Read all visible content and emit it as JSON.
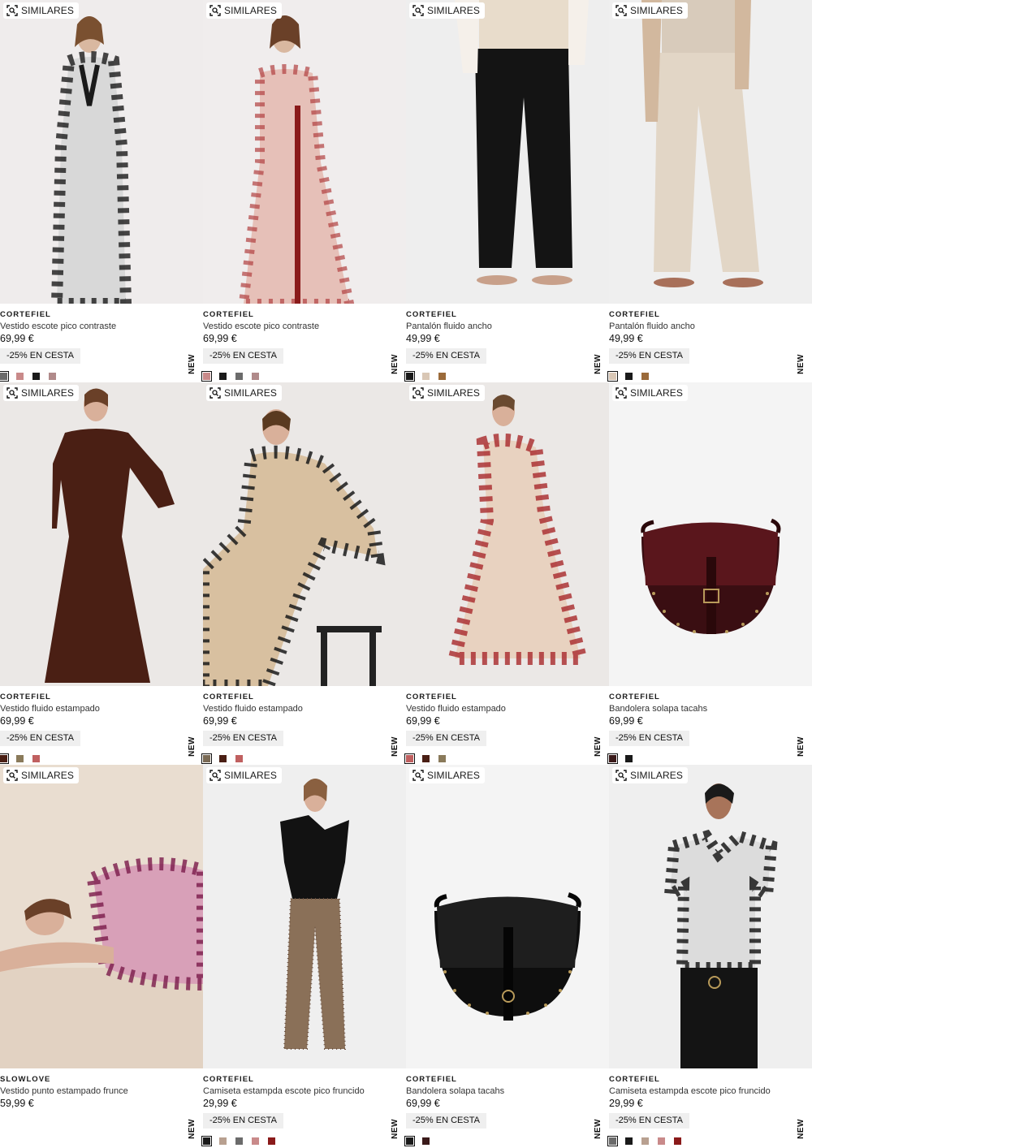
{
  "similar_label": "SIMILARES",
  "new_label": "NEW",
  "products": [
    {
      "brand": "CORTEFIEL",
      "name": "Vestido escote pico contraste",
      "price": "69,99 €",
      "promo": "-25% EN CESTA",
      "bg": "#efecec",
      "swatches": [
        "#6b6b6b",
        "#c98a8a",
        "#1a1a1a",
        "#b08a8a"
      ]
    },
    {
      "brand": "CORTEFIEL",
      "name": "Vestido escote pico contraste",
      "price": "69,99 €",
      "promo": "-25% EN CESTA",
      "bg": "#f0eded",
      "swatches": [
        "#c98a8a",
        "#1a1a1a",
        "#6b6b6b",
        "#b08a8a"
      ]
    },
    {
      "brand": "CORTEFIEL",
      "name": "Pantalón fluido ancho",
      "price": "49,99 €",
      "promo": "-25% EN CESTA",
      "bg": "#eeeeee",
      "swatches": [
        "#1a1a1a",
        "#d9c7b5",
        "#9b6a3a"
      ]
    },
    {
      "brand": "CORTEFIEL",
      "name": "Pantalón fluido ancho",
      "price": "49,99 €",
      "promo": "-25% EN CESTA",
      "bg": "#efefef",
      "swatches": [
        "#d9c7b5",
        "#1a1a1a",
        "#9b6a3a"
      ]
    },
    {
      "brand": "CORTEFIEL",
      "name": "Vestido fluido estampado",
      "price": "69,99 €",
      "promo": "-25% EN CESTA",
      "bg": "#ebe8e6",
      "swatches": [
        "#4a1f14",
        "#8a7a5a",
        "#c06060"
      ]
    },
    {
      "brand": "CORTEFIEL",
      "name": "Vestido fluido estampado",
      "price": "69,99 €",
      "promo": "-25% EN CESTA",
      "bg": "#ebe8e6",
      "swatches": [
        "#7a6a55",
        "#4a1f14",
        "#c06060"
      ]
    },
    {
      "brand": "CORTEFIEL",
      "name": "Vestido fluido estampado",
      "price": "69,99 €",
      "promo": "-25% EN CESTA",
      "bg": "#ebe8e6",
      "swatches": [
        "#c06060",
        "#4a1f14",
        "#8a7a5a"
      ]
    },
    {
      "brand": "CORTEFIEL",
      "name": "Bandolera solapa tacahs",
      "price": "69,99 €",
      "promo": "-25% EN CESTA",
      "bg": "#f4f4f4",
      "swatches": [
        "#3a1a1a",
        "#1a1a1a"
      ]
    },
    {
      "brand": "SLOWLOVE",
      "name": "Vestido punto estampado frunce",
      "price": "59,99 €",
      "promo": "",
      "bg": "#e9ddd0",
      "swatches": []
    },
    {
      "brand": "CORTEFIEL",
      "name": "Camiseta estampda escote pico fruncido",
      "price": "29,99 €",
      "promo": "-25% EN CESTA",
      "bg": "#efefef",
      "swatches": [
        "#1a1a1a",
        "#b8a090",
        "#6b6b6b",
        "#c98a8a",
        "#8a1a1a"
      ]
    },
    {
      "brand": "CORTEFIEL",
      "name": "Bandolera solapa tacahs",
      "price": "69,99 €",
      "promo": "-25% EN CESTA",
      "bg": "#f4f4f4",
      "swatches": [
        "#1a1a1a",
        "#3a1a1a"
      ]
    },
    {
      "brand": "CORTEFIEL",
      "name": "Camiseta estampda escote pico fruncido",
      "price": "29,99 €",
      "promo": "-25% EN CESTA",
      "bg": "#efefef",
      "swatches": [
        "#6b6b6b",
        "#1a1a1a",
        "#b8a090",
        "#c98a8a",
        "#8a1a1a"
      ]
    }
  ]
}
